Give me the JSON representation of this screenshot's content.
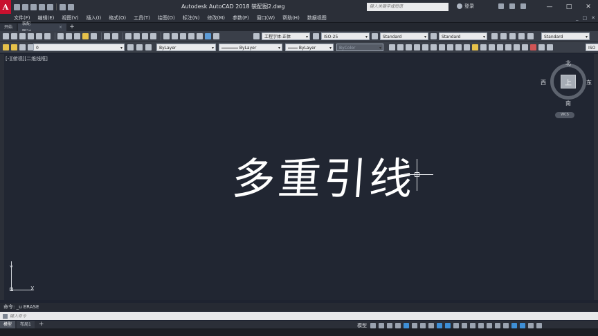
{
  "app": {
    "logo_letter": "A",
    "title": "Autodesk AutoCAD 2018    装配图2.dwg",
    "search_placeholder": "键入关键字或短语",
    "login_label": "登录"
  },
  "window_controls": [
    "—",
    "□",
    "✕"
  ],
  "menu": {
    "items": [
      "文件(F)",
      "编辑(E)",
      "视图(V)",
      "插入(I)",
      "格式(O)",
      "工具(T)",
      "绘图(D)",
      "标注(N)",
      "修改(M)",
      "参数(P)",
      "窗口(W)",
      "帮助(H)",
      "数据视图"
    ],
    "right": [
      "_",
      "□",
      "✕"
    ]
  },
  "tabs": {
    "items": [
      {
        "label": "开始",
        "active": false
      },
      {
        "label": "装配图2*",
        "active": true,
        "close": "×"
      }
    ],
    "add": "+"
  },
  "toolbar1": {
    "text_style": "工程字体-正体",
    "dim_style": "ISO-25",
    "table_style": "Standard",
    "mleader_style": "Standard",
    "style4": "Standard"
  },
  "toolbar2": {
    "layer": "0",
    "color": "ByLayer",
    "linetype": "ByLayer",
    "lineweight": "ByLayer",
    "plotstyle": "ByColor",
    "right_combo": "ISO"
  },
  "canvas": {
    "view_label": "[-][俯视][二维线框]",
    "main_text": "多重引线"
  },
  "viewcube": {
    "north": "北",
    "south": "南",
    "west": "西",
    "east": "东",
    "face": "上",
    "wcs": "WCS"
  },
  "ucs": {
    "x_label": "X",
    "y_label": "Y"
  },
  "command": {
    "history": "命令:  _u  ERASE",
    "placeholder": "键入命令"
  },
  "layout_tabs": {
    "items": [
      {
        "label": "模型",
        "active": true
      },
      {
        "label": "布局1",
        "active": false
      }
    ],
    "add": "+"
  },
  "status": {
    "model_label": "模型"
  }
}
